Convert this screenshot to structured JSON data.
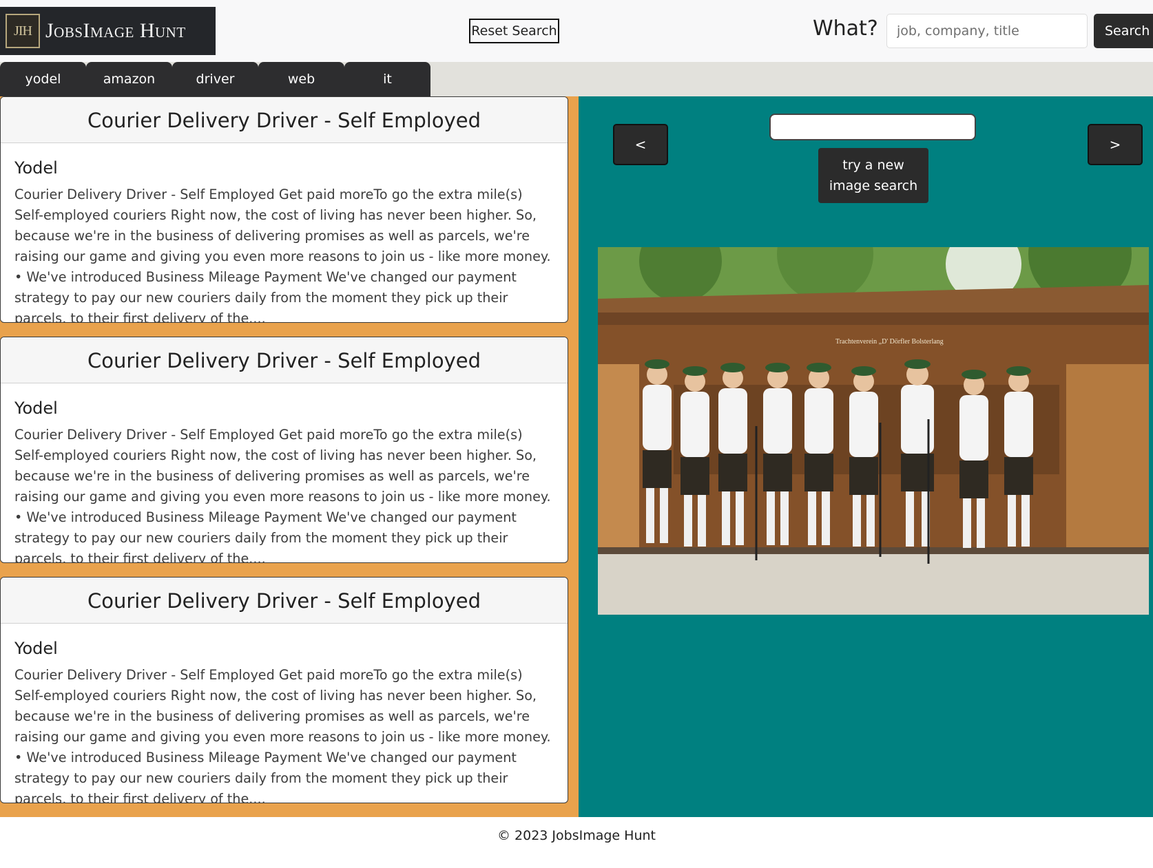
{
  "header": {
    "logo_mark": "JIH",
    "logo_text": "JobsImage Hunt",
    "reset_label": "Reset Search",
    "what_label": "What?",
    "search_placeholder": "job, company, title",
    "search_value": "",
    "search_label": "Search"
  },
  "tags": [
    "yodel",
    "amazon",
    "driver",
    "web",
    "it"
  ],
  "jobs": [
    {
      "title": "Courier Delivery Driver - Self Employed",
      "company": "Yodel",
      "description": "Courier Delivery Driver - Self Employed Get paid moreTo go the extra mile(s) Self-employed couriers Right now, the cost of living has never been higher. So, because we're in the business of delivering promises as well as parcels, we're raising our game and giving you even more reasons to join us - like more money. • We've introduced Business Mileage Payment We've changed our payment strategy to pay our new couriers daily from the moment they pick up their parcels, to their first delivery of the...."
    },
    {
      "title": "Courier Delivery Driver - Self Employed",
      "company": "Yodel",
      "description": "Courier Delivery Driver - Self Employed Get paid moreTo go the extra mile(s) Self-employed couriers Right now, the cost of living has never been higher. So, because we're in the business of delivering promises as well as parcels, we're raising our game and giving you even more reasons to join us - like more money. • We've introduced Business Mileage Payment We've changed our payment strategy to pay our new couriers daily from the moment they pick up their parcels, to their first delivery of the...."
    },
    {
      "title": "Courier Delivery Driver - Self Employed",
      "company": "Yodel",
      "description": "Courier Delivery Driver - Self Employed Get paid moreTo go the extra mile(s) Self-employed couriers Right now, the cost of living has never been higher. So, because we're in the business of delivering promises as well as parcels, we're raising our game and giving you even more reasons to join us - like more money. • We've introduced Business Mileage Payment We've changed our payment strategy to pay our new couriers daily from the moment they pick up their parcels, to their first delivery of the...."
    }
  ],
  "image_panel": {
    "prev_label": "<",
    "next_label": ">",
    "query_value": "",
    "new_search_label": "try a new image search",
    "photo_sign": "Trachtenverein  „D' Dörfler  Bolsterlang"
  },
  "footer": {
    "copyright": "© 2023 JobsImage Hunt"
  },
  "colors": {
    "header_bg": "#f8f8f9",
    "tag_bar_bg": "#e2e1dc",
    "dark_button": "#2b2b2b",
    "left_panel_bg": "#e9a24c",
    "right_panel_bg": "#008080"
  }
}
